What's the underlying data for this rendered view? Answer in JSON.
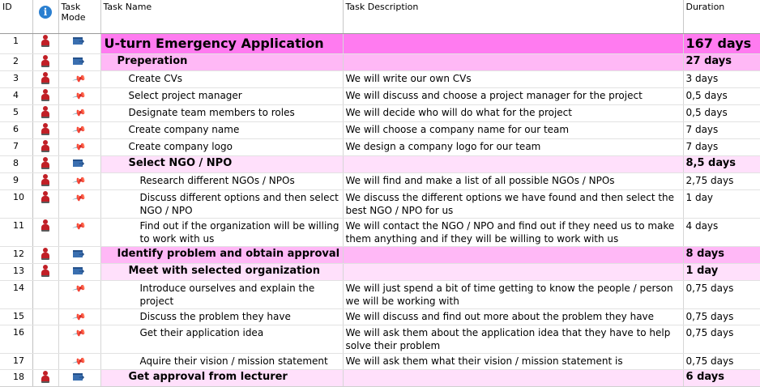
{
  "columns": {
    "id": "ID",
    "indicator_icon": "info-icon",
    "task_mode": "Task Mode",
    "task_name": "Task Name",
    "task_description": "Task Description",
    "duration": "Duration"
  },
  "icons": {
    "resource": "person-icon",
    "auto_scheduled": "auto-schedule-icon",
    "manual_scheduled": "pin-icon"
  },
  "colors": {
    "project_summary": "#ff7bf0",
    "summary": "#ffb8f6",
    "subsummary": "#ffe0fb"
  },
  "tasks": [
    {
      "id": "1",
      "name": "U-turn Emergency Application",
      "description": "",
      "duration": "167 days",
      "level": 0,
      "summary": true,
      "mode": "auto",
      "resource": true
    },
    {
      "id": "2",
      "name": "Preperation",
      "description": "",
      "duration": "27 days",
      "level": 1,
      "summary": true,
      "mode": "auto",
      "resource": true
    },
    {
      "id": "3",
      "name": "Create CVs",
      "description": "We will write our own CVs",
      "duration": "3 days",
      "level": 2,
      "summary": false,
      "mode": "manual",
      "resource": true
    },
    {
      "id": "4",
      "name": "Select project manager",
      "description": "We will discuss and choose a project manager for the project",
      "duration": "0,5 days",
      "level": 2,
      "summary": false,
      "mode": "manual",
      "resource": true
    },
    {
      "id": "5",
      "name": "Designate team members to roles",
      "description": "We will decide who will do what for the project",
      "duration": "0,5 days",
      "level": 2,
      "summary": false,
      "mode": "manual",
      "resource": true
    },
    {
      "id": "6",
      "name": "Create company name",
      "description": "We will choose a company name for our team",
      "duration": "7 days",
      "level": 2,
      "summary": false,
      "mode": "manual",
      "resource": true
    },
    {
      "id": "7",
      "name": "Create company logo",
      "description": "We design a company logo for our team",
      "duration": "7 days",
      "level": 2,
      "summary": false,
      "mode": "manual",
      "resource": true
    },
    {
      "id": "8",
      "name": "Select NGO / NPO",
      "description": "",
      "duration": "8,5 days",
      "level": 2,
      "summary": true,
      "mode": "auto",
      "resource": true
    },
    {
      "id": "9",
      "name": "Research different NGOs / NPOs",
      "description": "We will find and make a list of all possible NGOs / NPOs",
      "duration": "2,75 days",
      "level": 3,
      "summary": false,
      "mode": "manual",
      "resource": true
    },
    {
      "id": "10",
      "name": "Discuss different options and then select NGO / NPO",
      "description": "We discuss the different options we have found and then select the best NGO / NPO for us",
      "duration": "1 day",
      "level": 3,
      "summary": false,
      "mode": "manual",
      "resource": true
    },
    {
      "id": "11",
      "name": "Find out if the organization will be willing to work with us",
      "description": "We will contact the NGO / NPO and find out if they need us to make them anything and if they will be willing to work with us",
      "duration": "4 days",
      "level": 3,
      "summary": false,
      "mode": "manual",
      "resource": true
    },
    {
      "id": "12",
      "name": "Identify problem and obtain approval",
      "description": "",
      "duration": "8 days",
      "level": 1,
      "summary": true,
      "mode": "auto",
      "resource": true
    },
    {
      "id": "13",
      "name": "Meet with selected organization",
      "description": "",
      "duration": "1 day",
      "level": 2,
      "summary": true,
      "mode": "auto",
      "resource": true
    },
    {
      "id": "14",
      "name": "Introduce ourselves and explain the project",
      "description": "We will just spend a bit of time getting to know the people / person we will be working with",
      "duration": "0,75 days",
      "level": 3,
      "summary": false,
      "mode": "manual",
      "resource": false
    },
    {
      "id": "15",
      "name": "Discuss the problem they have",
      "description": "We will discuss and find out more about the problem they have",
      "duration": "0,75 days",
      "level": 3,
      "summary": false,
      "mode": "manual",
      "resource": false
    },
    {
      "id": "16",
      "name": "Get their application idea",
      "description": "We will ask them about the application idea that they have to help solve their problem",
      "duration": "0,75 days",
      "level": 3,
      "summary": false,
      "mode": "manual",
      "resource": false
    },
    {
      "id": "17",
      "name": "Aquire their vision / mission statement",
      "description": "We will ask them what their vision / mission statement is",
      "duration": "0,75 days",
      "level": 3,
      "summary": false,
      "mode": "manual",
      "resource": false
    },
    {
      "id": "18",
      "name": "Get approval from lecturer",
      "description": "",
      "duration": "6 days",
      "level": 2,
      "summary": true,
      "mode": "auto",
      "resource": true
    }
  ]
}
